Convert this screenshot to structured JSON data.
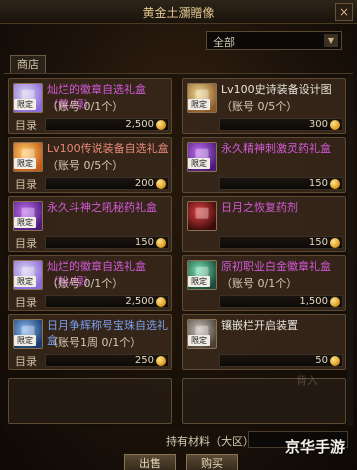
{
  "window": {
    "title": "黄金土瀰贈像",
    "close_label": "×"
  },
  "filter": {
    "selected": "全部",
    "arrow": "▼"
  },
  "tab": {
    "label": "商店"
  },
  "items": [
    {
      "name": "灿烂的徽章自选礼盒（黄/绿）",
      "limit": "（账号 0/1个）",
      "catalog": "目录",
      "price": "2,500",
      "tag": "限定",
      "name_color": "purple",
      "icon": "gift-box-icon"
    },
    {
      "name": "Lv100史诗装备设计图",
      "limit": "（账号 0/5个）",
      "catalog": "",
      "price": "300",
      "tag": "限定",
      "name_color": "white",
      "icon": "scroll-icon"
    },
    {
      "name": "Lv100传说装备自选礼盒",
      "limit": "（账号 0/5个）",
      "catalog": "目录",
      "price": "200",
      "tag": "限定",
      "name_color": "red",
      "icon": "chest-icon"
    },
    {
      "name": "永久精神刺激灵药礼盒",
      "limit": "",
      "catalog": "",
      "price": "150",
      "tag": "限定",
      "name_color": "purple",
      "icon": "potion-box-icon"
    },
    {
      "name": "永久斗神之吼秘药礼盒",
      "limit": "",
      "catalog": "目录",
      "price": "150",
      "tag": "限定",
      "name_color": "purple",
      "icon": "potion-box-icon"
    },
    {
      "name": "日月之恢复药剂",
      "limit": "",
      "catalog": "",
      "price": "150",
      "tag": "",
      "name_color": "purple",
      "icon": "red-potion-icon"
    },
    {
      "name": "灿烂的徽章自选礼盒（粉/绿）",
      "limit": "（账号 0/1个）",
      "catalog": "目录",
      "price": "2,500",
      "tag": "限定",
      "name_color": "purple",
      "icon": "gift-box-icon"
    },
    {
      "name": "原初职业白金徽章礼盒",
      "limit": "（账号 0/1个）",
      "catalog": "",
      "price": "1,500",
      "tag": "限定",
      "name_color": "purple",
      "icon": "badge-box-icon"
    },
    {
      "name": "日月争辉称号宝珠自选礼盒",
      "limit": "（账号1周 0/1个）",
      "catalog": "目录",
      "price": "250",
      "tag": "限定",
      "name_color": "blue",
      "icon": "orb-box-icon"
    },
    {
      "name": "镶嵌栏开启装置",
      "limit": "",
      "catalog": "",
      "price": "50",
      "tag": "限定",
      "name_color": "white",
      "icon": "device-icon"
    }
  ],
  "footer": {
    "material_label": "持有材料（大区）",
    "material_value": "",
    "buy_label": "出售",
    "purchase_label": "购买"
  },
  "overlay": {
    "watermark": "背入",
    "logo": "京华手游"
  }
}
